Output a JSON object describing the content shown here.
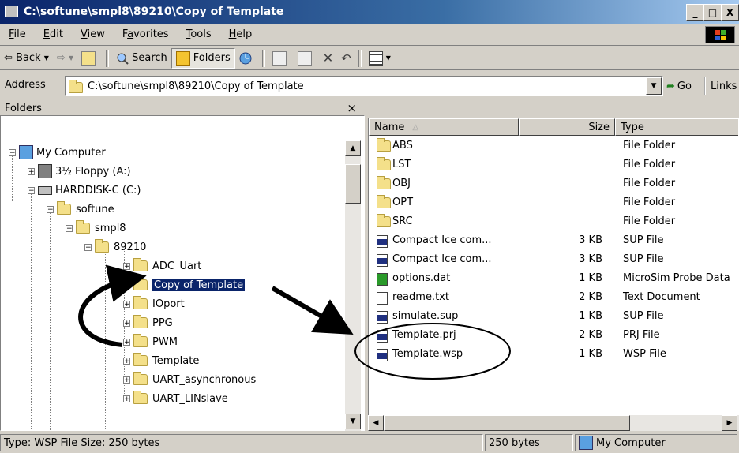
{
  "window": {
    "title": "C:\\softune\\smpl8\\89210\\Copy of Template"
  },
  "menu": [
    {
      "pre": "",
      "u": "F",
      "post": "ile"
    },
    {
      "pre": "",
      "u": "E",
      "post": "dit"
    },
    {
      "pre": "",
      "u": "V",
      "post": "iew"
    },
    {
      "pre": "F",
      "u": "a",
      "post": "vorites"
    },
    {
      "pre": "",
      "u": "T",
      "post": "ools"
    },
    {
      "pre": "",
      "u": "H",
      "post": "elp"
    }
  ],
  "toolbar": {
    "back": "Back",
    "search": "Search",
    "folders": "Folders"
  },
  "address": {
    "label": "Address",
    "value": "C:\\softune\\smpl8\\89210\\Copy of Template",
    "go": "Go",
    "links": "Links"
  },
  "folders_pane": {
    "header": "Folders",
    "close": "×",
    "items": [
      {
        "label": "My Computer"
      },
      {
        "label": "3½ Floppy (A:)"
      },
      {
        "label": "HARDDISK-C (C:)"
      },
      {
        "label": "softune"
      },
      {
        "label": "smpl8"
      },
      {
        "label": "89210"
      },
      {
        "label": "ADC_Uart"
      },
      {
        "label": "Copy of Template"
      },
      {
        "label": "IOport"
      },
      {
        "label": "PPG"
      },
      {
        "label": "PWM"
      },
      {
        "label": "Template"
      },
      {
        "label": "UART_asynchronous"
      },
      {
        "label": "UART_LINslave"
      }
    ]
  },
  "list": {
    "columns": {
      "name": "Name",
      "size": "Size",
      "type": "Type"
    },
    "rows": [
      {
        "name": "ABS",
        "size": "",
        "type": "File Folder",
        "icon": "folder-icon"
      },
      {
        "name": "LST",
        "size": "",
        "type": "File Folder",
        "icon": "folder-icon"
      },
      {
        "name": "OBJ",
        "size": "",
        "type": "File Folder",
        "icon": "folder-icon"
      },
      {
        "name": "OPT",
        "size": "",
        "type": "File Folder",
        "icon": "folder-icon"
      },
      {
        "name": "SRC",
        "size": "",
        "type": "File Folder",
        "icon": "folder-icon"
      },
      {
        "name": "Compact Ice com...",
        "size": "3 KB",
        "type": "SUP File",
        "icon": "sup-file-icon"
      },
      {
        "name": "Compact Ice com...",
        "size": "3 KB",
        "type": "SUP File",
        "icon": "sup-file-icon"
      },
      {
        "name": "options.dat",
        "size": "1 KB",
        "type": "MicroSim Probe Data",
        "icon": "probe-data-icon"
      },
      {
        "name": "readme.txt",
        "size": "2 KB",
        "type": "Text Document",
        "icon": "text-file-icon"
      },
      {
        "name": "simulate.sup",
        "size": "1 KB",
        "type": "SUP File",
        "icon": "sup-file-icon"
      },
      {
        "name": "Template.prj",
        "size": "2 KB",
        "type": "PRJ File",
        "icon": "prj-file-icon"
      },
      {
        "name": "Template.wsp",
        "size": "1 KB",
        "type": "WSP File",
        "icon": "wsp-file-icon"
      }
    ]
  },
  "status": {
    "info": "Type: WSP File Size: 250 bytes",
    "size": "250 bytes",
    "zone": "My Computer"
  }
}
